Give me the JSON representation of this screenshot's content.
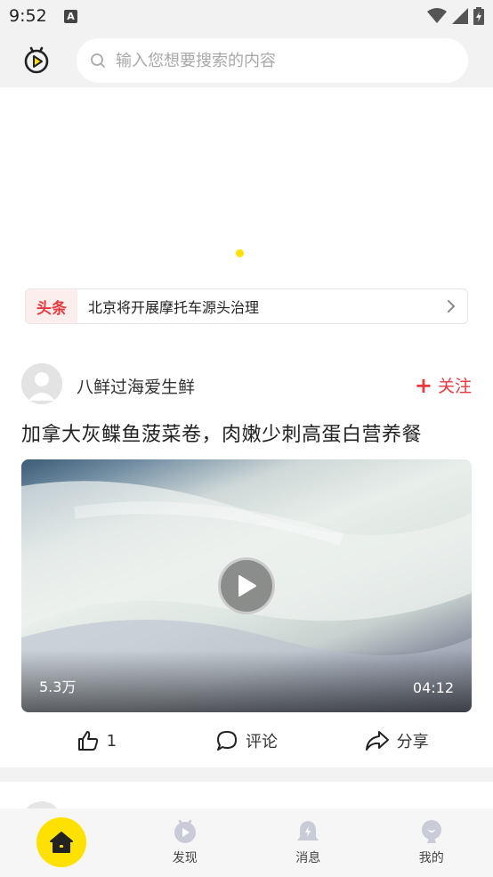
{
  "status": {
    "time": "9:52",
    "notification_icon": "A"
  },
  "search": {
    "placeholder": "输入您想要搜索的内容"
  },
  "headline": {
    "tag": "头条",
    "text": "北京将开展摩托车源头治理"
  },
  "post": {
    "author": "八鲜过海爱生鲜",
    "follow_label": "关注",
    "title": "加拿大灰鲽鱼菠菜卷，肉嫩少刺高蛋白营养餐",
    "views": "5.3万",
    "duration": "04:12",
    "like_count": "1",
    "comment_label": "评论",
    "share_label": "分享"
  },
  "tabs": [
    {
      "label": "",
      "icon": "home-icon"
    },
    {
      "label": "发现",
      "icon": "discover-icon"
    },
    {
      "label": "消息",
      "icon": "bell-icon"
    },
    {
      "label": "我的",
      "icon": "profile-icon"
    }
  ],
  "colors": {
    "accent": "#ffe100",
    "red": "#e8383d",
    "background": "#f2f2f2"
  }
}
